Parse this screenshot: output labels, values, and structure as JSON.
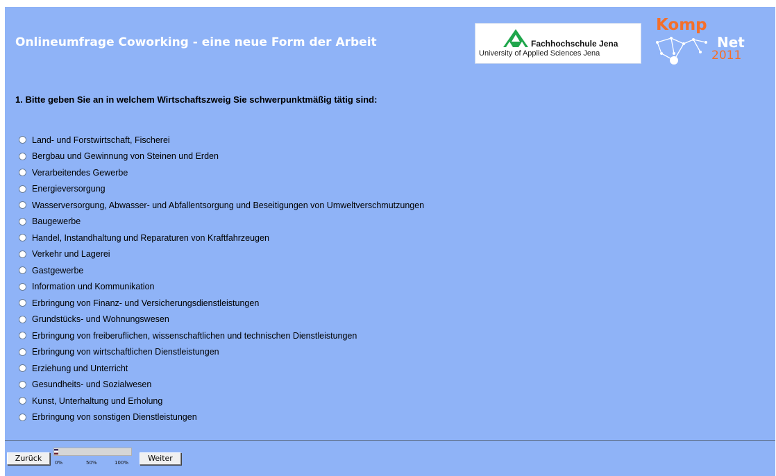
{
  "header": {
    "title": "Onlineumfrage Coworking - eine neue Form der Arbeit",
    "fh_logo_name": "Fachhochschule Jena",
    "fh_logo_subtitle": "University of Applied Sciences Jena",
    "komp_logo_line1": "Komp",
    "komp_logo_line2": "Net",
    "komp_logo_line3": "2011"
  },
  "question": {
    "text": "1. Bitte geben Sie an in welchem Wirtschaftszweig Sie schwerpunktmäßig tätig sind:",
    "options": [
      "Land- und Forstwirtschaft, Fischerei",
      "Bergbau und Gewinnung von Steinen und Erden",
      "Verarbeitendes Gewerbe",
      "Energieversorgung",
      "Wasserversorgung, Abwasser- und Abfallentsorgung und Beseitigungen von Umweltverschmutzungen",
      "Baugewerbe",
      "Handel, Instandhaltung und Reparaturen von Kraftfahrzeugen",
      "Verkehr und Lagerei",
      "Gastgewerbe",
      "Information und Kommunikation",
      "Erbringung von Finanz- und Versicherungsdienstleistungen",
      "Grundstücks- und Wohnungswesen",
      "Erbringung von freiberuflichen, wissenschaftlichen und technischen Dienstleistungen",
      "Erbringung von wirtschaftlichen Dienstleistungen",
      "Erziehung und Unterricht",
      "Gesundheits- und Sozialwesen",
      "Kunst, Unterhaltung und Erholung",
      "Erbringung von sonstigen Dienstleistungen"
    ]
  },
  "navigation": {
    "back_label": "Zurück",
    "next_label": "Weiter",
    "progress_fraction": 0.05,
    "progress_ticks": [
      "0%",
      "50%",
      "100%"
    ]
  },
  "colors": {
    "background": "#8fb3f7",
    "title_text": "#ffffff",
    "logo_orange": "#f46f2a",
    "logo_green": "#1fa64b"
  }
}
